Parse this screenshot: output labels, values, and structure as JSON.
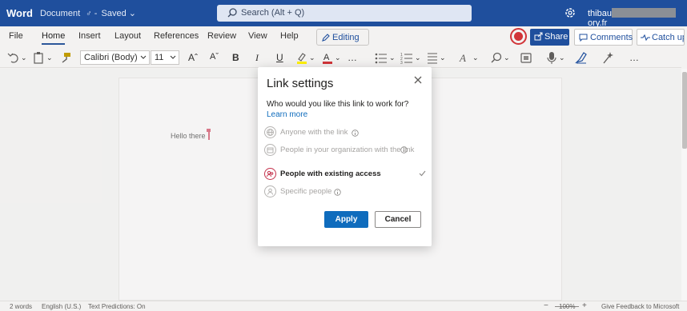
{
  "titlebar": {
    "app_name": "Word",
    "doc_name": "Document",
    "saved_status": "Saved",
    "search_placeholder": "Search (Alt + Q)",
    "user_prefix": "thibau",
    "user_suffix": "ory.fr"
  },
  "ribbon_tabs": [
    "File",
    "Home",
    "Insert",
    "Layout",
    "References",
    "Review",
    "View",
    "Help"
  ],
  "active_tab": "Home",
  "ribbon_actions": {
    "editing_label": "Editing",
    "share_label": "Share",
    "comments_label": "Comments",
    "catchup_label": "Catch up"
  },
  "toolbar": {
    "font_name": "Calibri (Body)",
    "font_size": "11"
  },
  "document": {
    "text": "Hello there"
  },
  "dialog": {
    "title": "Link settings",
    "question": "Who would you like this link to work for?",
    "learn_more": "Learn more",
    "options": [
      {
        "label": "Anyone with the link",
        "selected": false,
        "icon": "globe-icon"
      },
      {
        "label": "People in your organization with the link",
        "selected": false,
        "icon": "building-icon"
      },
      {
        "label": "People with existing access",
        "selected": true,
        "icon": "people-icon"
      },
      {
        "label": "Specific people",
        "selected": false,
        "icon": "person-icon"
      }
    ],
    "apply_label": "Apply",
    "cancel_label": "Cancel"
  },
  "statusbar": {
    "word_count": "2 words",
    "language": "English (U.S.)",
    "predictions": "Text Predictions: On",
    "zoom": "100%",
    "feedback": "Give Feedback to Microsoft"
  },
  "colors": {
    "titlebar": "#1f4f9d",
    "accent": "#0f6cbd",
    "record": "#d13438"
  }
}
